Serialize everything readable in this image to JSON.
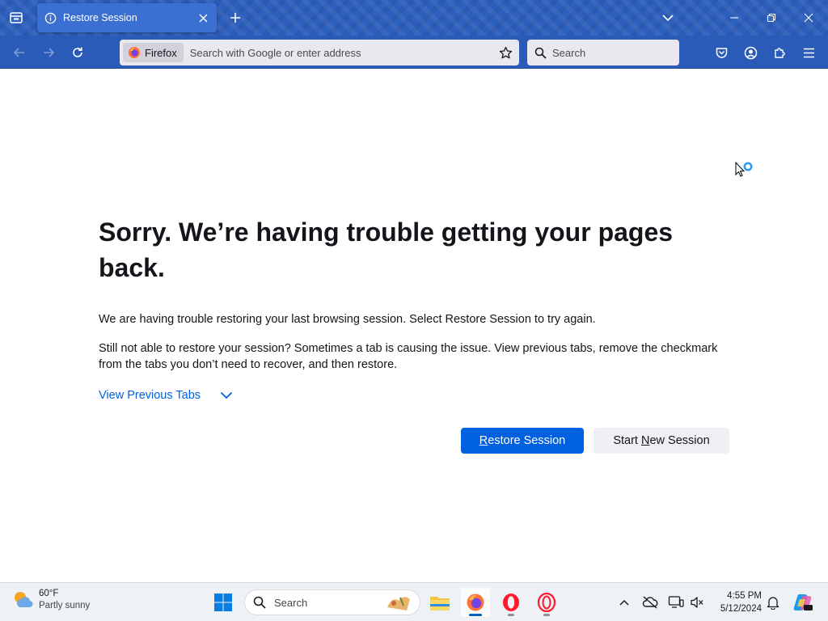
{
  "browser": {
    "tab": {
      "title": "Restore Session"
    },
    "urlbar": {
      "identity_label": "Firefox",
      "placeholder": "Search with Google or enter address",
      "value": ""
    },
    "searchbar": {
      "placeholder": "Search",
      "value": ""
    }
  },
  "page": {
    "heading": "Sorry. We’re having trouble getting your pages back.",
    "paragraph1": "We are having trouble restoring your last browsing session. Select Restore Session to try again.",
    "paragraph2": "Still not able to restore your session? Sometimes a tab is causing the issue. View previous tabs, remove the checkmark from the tabs you don’t need to recover, and then restore.",
    "view_previous_tabs_label": "View Previous Tabs",
    "restore_button": {
      "access_key": "R",
      "rest": "estore Session"
    },
    "new_session_button": {
      "before": "Start ",
      "access_key": "N",
      "after": "ew Session"
    }
  },
  "taskbar": {
    "weather": {
      "temp": "60°F",
      "description": "Partly sunny"
    },
    "search_label": "Search",
    "clock": {
      "time": "4:55 PM",
      "date": "5/12/2024"
    }
  },
  "colors": {
    "toolbar": "#2b5bb8",
    "accent_button": "#0061e0",
    "link": "#0061e0"
  }
}
